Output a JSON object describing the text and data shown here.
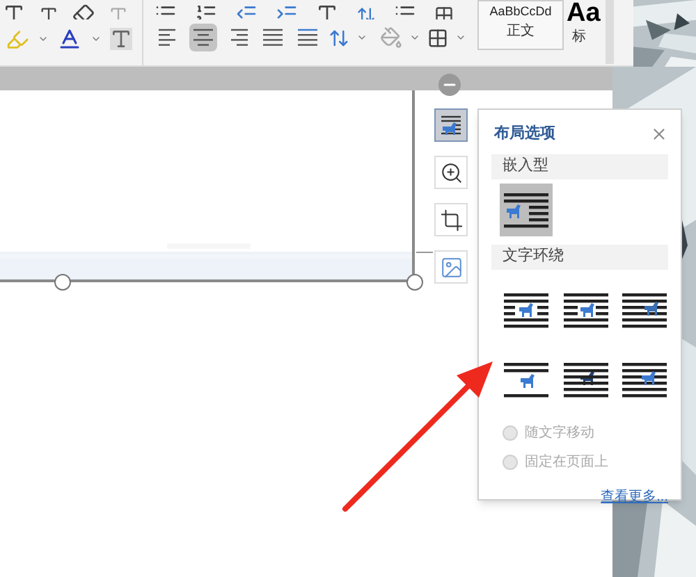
{
  "ribbon": {
    "align_buttons": [
      {
        "kind": "left",
        "selected": false
      },
      {
        "kind": "center",
        "selected": true
      },
      {
        "kind": "right",
        "selected": false
      },
      {
        "kind": "justify",
        "selected": false
      },
      {
        "kind": "distribute",
        "selected": false
      }
    ],
    "style_gallery": [
      {
        "preview": "AaBbCcDd",
        "label": "正文"
      },
      {
        "preview": "Aa",
        "label": "标"
      }
    ]
  },
  "side_tools": [
    {
      "kind": "layout",
      "selected": true
    },
    {
      "kind": "zoom",
      "selected": false
    },
    {
      "kind": "crop",
      "selected": false
    },
    {
      "kind": "frame",
      "selected": false
    }
  ],
  "layout_popup": {
    "title": "布局选项",
    "sections": [
      {
        "heading": "嵌入型",
        "options": [
          {
            "kind": "inline",
            "selected": true
          }
        ]
      },
      {
        "heading": "文字环绕",
        "options": [
          {
            "kind": "square",
            "selected": false
          },
          {
            "kind": "tight",
            "selected": false
          },
          {
            "kind": "through",
            "selected": false
          },
          {
            "kind": "top-bottom",
            "selected": false
          },
          {
            "kind": "behind",
            "selected": false
          },
          {
            "kind": "in-front",
            "selected": false
          }
        ]
      }
    ],
    "radios": [
      {
        "label": "随文字移动",
        "disabled": true,
        "selected": false
      },
      {
        "label": "固定在页面上",
        "disabled": true,
        "selected": false
      }
    ],
    "link": "查看更多..."
  }
}
